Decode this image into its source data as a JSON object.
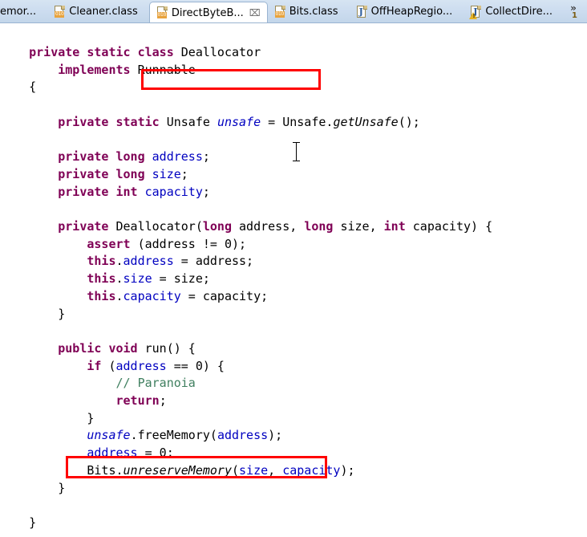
{
  "window": {
    "app": "eclipse-java-editor",
    "accent_red": "#ff0000",
    "keyword_color": "#7f0055",
    "field_color": "#0000c0",
    "comment_color": "#3f7f5f"
  },
  "tab_bar": {
    "tabs": [
      {
        "label": "emor...",
        "icon": "class-file-icon",
        "active": false,
        "truncated_left": true,
        "closable": false
      },
      {
        "label": "Cleaner.class",
        "icon": "class-file-icon",
        "active": false,
        "closable": false
      },
      {
        "label": "DirectByteB...",
        "icon": "class-file-icon",
        "active": true,
        "closable": true,
        "close_label": "⌧"
      },
      {
        "label": "Bits.class",
        "icon": "class-file-icon",
        "active": false,
        "closable": false
      },
      {
        "label": "OffHeapRegio...",
        "icon": "java-file-icon",
        "active": false,
        "closable": false
      },
      {
        "label": "CollectDire...",
        "icon": "java-file-warning-icon",
        "active": false,
        "closable": false
      }
    ],
    "overflow": {
      "chevron": "»",
      "hidden_count": "1"
    }
  },
  "editor": {
    "language": "Java",
    "lines": [
      "private static class Deallocator",
      "    implements Runnable",
      "{",
      "",
      "    private static Unsafe unsafe = Unsafe.getUnsafe();",
      "",
      "    private long address;",
      "    private long size;",
      "    private int capacity;",
      "",
      "    private Deallocator(long address, long size, int capacity) {",
      "        assert (address != 0);",
      "        this.address = address;",
      "        this.size = size;",
      "        this.capacity = capacity;",
      "    }",
      "",
      "    public void run() {",
      "        if (address == 0) {",
      "            // Paranoia",
      "            return;",
      "        }",
      "        unsafe.freeMemory(address);",
      "        address = 0;",
      "        Bits.unreserveMemory(size, capacity);",
      "    }",
      "",
      "}"
    ]
  },
  "annotations": [
    {
      "name": "class-declaration-highlight",
      "target_text": "class Deallocator",
      "color": "#ff0000"
    },
    {
      "name": "free-memory-call-highlight",
      "target_text": "unsafe.freeMemory(address);",
      "color": "#ff0000"
    }
  ],
  "caret": {
    "name": "text-cursor",
    "over_token": "="
  }
}
